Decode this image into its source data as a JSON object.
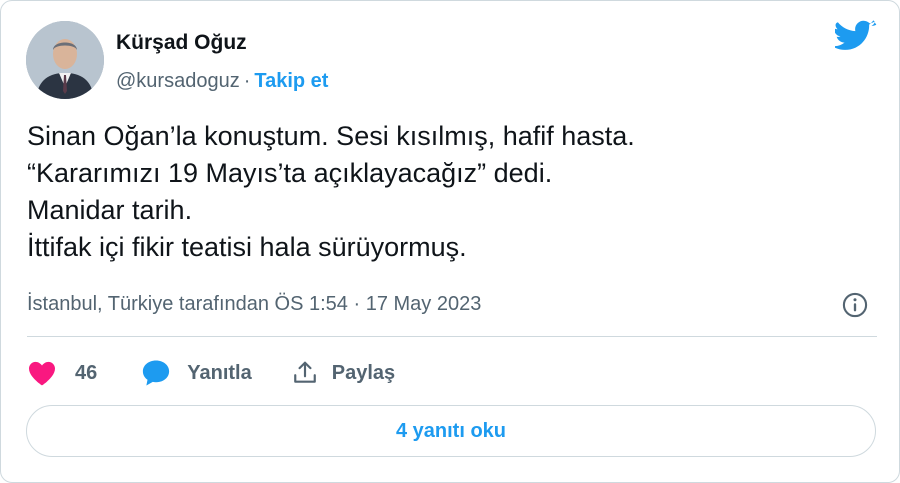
{
  "author": {
    "name": "Kürşad Oğuz",
    "handle": "@kursadoguz",
    "separator": "·",
    "follow_label": "Takip et"
  },
  "tweet": {
    "lines": [
      "Sinan Oğan’la konuştum. Sesi kısılmış, hafif hasta.",
      "“Kararımızı 19 Mayıs’ta açıklayacağız” dedi.",
      "Manidar tarih.",
      "İttifak içi fikir teatisi hala sürüyormuş."
    ],
    "meta": "İstanbul, Türkiye tarafından ÖS 1:54 · 17 May 2023"
  },
  "actions": {
    "like_count": "46",
    "reply_label": "Yanıtla",
    "share_label": "Paylaş"
  },
  "read_replies_label": "4 yanıtı oku",
  "colors": {
    "accent": "#1d9bf0",
    "like": "#f91880",
    "text": "#0f1419",
    "muted": "#536471",
    "border": "#cfd9de"
  },
  "icons": {
    "brand": "twitter-bird-icon",
    "info": "info-icon",
    "like": "heart-icon",
    "reply": "speech-bubble-icon",
    "share": "share-upload-icon"
  }
}
